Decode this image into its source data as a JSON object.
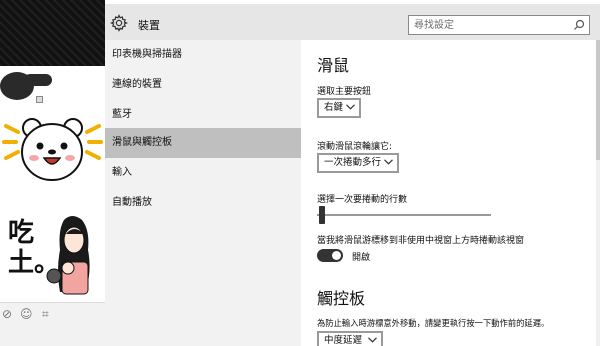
{
  "window": {
    "title": "設定",
    "header_title": "裝置",
    "search_placeholder": "尋找設定"
  },
  "sidebar": {
    "items": [
      {
        "label": "印表機與掃描器",
        "selected": false
      },
      {
        "label": "連線的裝置",
        "selected": false
      },
      {
        "label": "藍牙",
        "selected": false
      },
      {
        "label": "滑鼠與觸控板",
        "selected": true
      },
      {
        "label": "輸入",
        "selected": false
      },
      {
        "label": "自動播放",
        "selected": false
      }
    ]
  },
  "mouse": {
    "heading": "滑鼠",
    "primary_button_label": "選取主要按鈕",
    "primary_button_value": "右鍵",
    "scroll_label": "滾動滑鼠滾輪讓它:",
    "scroll_value": "一次捲動多行",
    "lines_label": "選擇一次要捲動的行數",
    "lines_level": 0.01,
    "inactive_scroll_label": "當我將滑鼠游標移到非使用中視窗上方時捲動該視窗",
    "inactive_scroll_state": "開啟",
    "inactive_scroll_on": true
  },
  "touchpad": {
    "heading": "觸控板",
    "delay_label": "為防止輸入時游標意外移動，請變更執行按一下動作前的延遲。",
    "delay_value": "中度延遲"
  },
  "background_app": {
    "comic_text": "吃土。"
  },
  "colors": {
    "header_bg": "#e6e6e6",
    "sidebar_bg": "#f2f2f2",
    "selected_bg": "#bfbfbf",
    "toggle_on": "#333333"
  }
}
